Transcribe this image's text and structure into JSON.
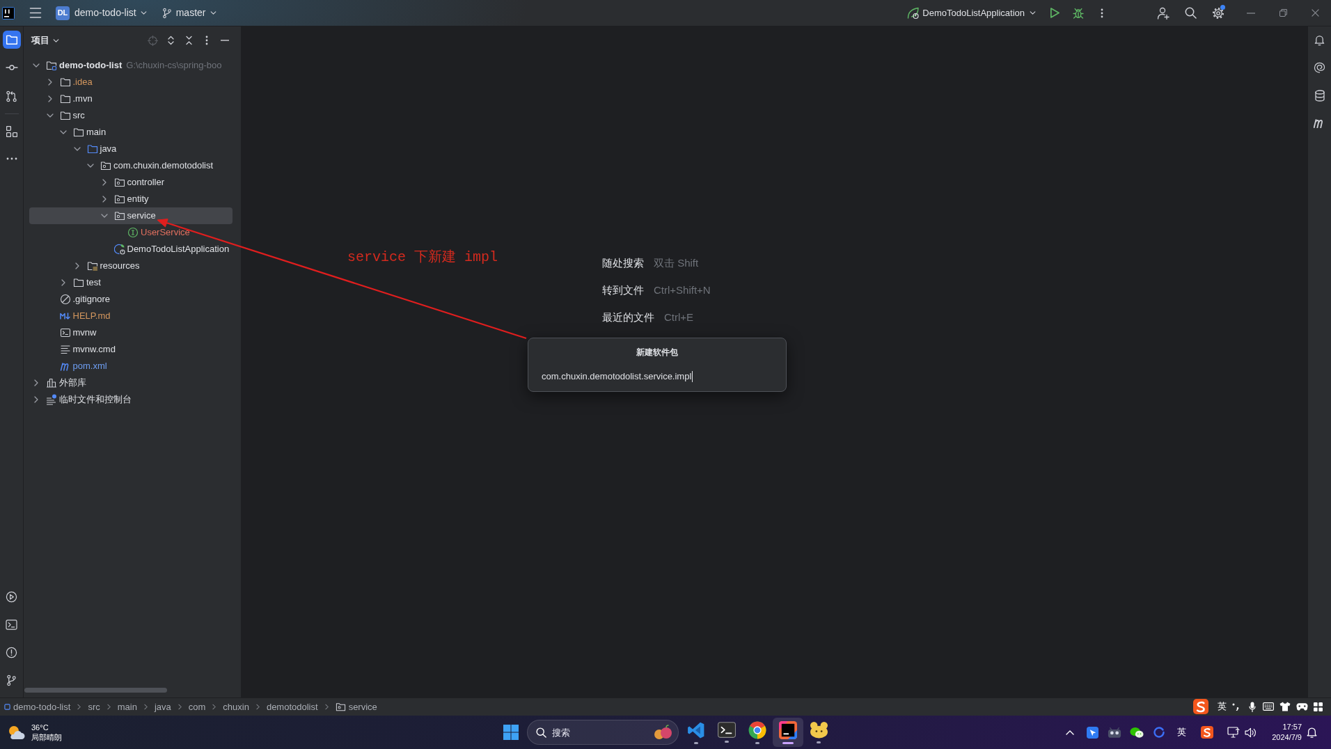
{
  "title_bar": {
    "project": {
      "badge": "DL",
      "name": "demo-todo-list"
    },
    "branch": "master",
    "run_configuration": "DemoTodoListApplication",
    "settings_update": true
  },
  "left_toolbar": {
    "top": [
      {
        "kind": "project",
        "selected": true
      },
      {
        "kind": "commit",
        "selected": false
      },
      {
        "kind": "pull_requests",
        "selected": false
      },
      {
        "kind": "structure",
        "selected": false
      },
      {
        "kind": "more",
        "selected": false
      }
    ],
    "bottom": [
      {
        "kind": "services",
        "selected": false
      },
      {
        "kind": "terminal",
        "selected": false
      },
      {
        "kind": "problems",
        "selected": false
      },
      {
        "kind": "git",
        "selected": false
      }
    ]
  },
  "project_panel": {
    "title": "项目",
    "tree": [
      {
        "label": "demo-todo-list",
        "kind": "module",
        "path": "G:\\chuxin-cs\\spring-boo",
        "expanded": true,
        "selected": false,
        "children": [
          {
            "label": ".idea",
            "kind": "folder",
            "color": "#d4975e",
            "expanded": false,
            "selected": false
          },
          {
            "label": ".mvn",
            "kind": "folder",
            "expanded": false,
            "selected": false
          },
          {
            "label": "src",
            "kind": "folder",
            "expanded": true,
            "selected": false,
            "children": [
              {
                "label": "main",
                "kind": "folder",
                "expanded": true,
                "selected": false,
                "children": [
                  {
                    "label": "java",
                    "kind": "source_root",
                    "expanded": true,
                    "selected": false,
                    "children": [
                      {
                        "label": "com.chuxin.demotodolist",
                        "kind": "package",
                        "expanded": true,
                        "selected": false,
                        "children": [
                          {
                            "label": "controller",
                            "kind": "package",
                            "expanded": false,
                            "selected": false
                          },
                          {
                            "label": "entity",
                            "kind": "package",
                            "expanded": false,
                            "selected": false
                          },
                          {
                            "label": "service",
                            "kind": "package",
                            "expanded": true,
                            "selected": true,
                            "children": [
                              {
                                "label": "UserService",
                                "kind": "interface",
                                "color": "#e2705f",
                                "selected": false
                              }
                            ]
                          },
                          {
                            "label": "DemoTodoListApplication",
                            "kind": "application_class",
                            "selected": false
                          }
                        ]
                      }
                    ]
                  },
                  {
                    "label": "resources",
                    "kind": "resources_root",
                    "expanded": false,
                    "selected": false
                  }
                ]
              },
              {
                "label": "test",
                "kind": "folder",
                "expanded": false,
                "selected": false
              }
            ]
          },
          {
            "label": ".gitignore",
            "kind": "ignore_file",
            "selected": false
          },
          {
            "label": "HELP.md",
            "kind": "markdown",
            "color": "#d4975e",
            "selected": false
          },
          {
            "label": "mvnw",
            "kind": "shell_script",
            "selected": false
          },
          {
            "label": "mvnw.cmd",
            "kind": "text_file",
            "selected": false
          },
          {
            "label": "pom.xml",
            "kind": "maven_pom",
            "color": "#6e9ef2",
            "selected": false
          }
        ]
      },
      {
        "label": "外部库",
        "kind": "libraries",
        "expanded": false,
        "selected": false
      },
      {
        "label": "临时文件和控制台",
        "kind": "scratches",
        "expanded": false,
        "selected": false
      }
    ]
  },
  "annotation": {
    "text": "service 下新建 impl"
  },
  "editor": {
    "hints": [
      {
        "action": "随处搜索",
        "shortcut": "双击 Shift"
      },
      {
        "action": "转到文件",
        "shortcut": "Ctrl+Shift+N"
      },
      {
        "action": "最近的文件",
        "shortcut": "Ctrl+E"
      }
    ]
  },
  "new_package_dialog": {
    "title": "新建软件包",
    "value": "com.chuxin.demotodolist.service.impl",
    "focused": true
  },
  "right_toolbar": [
    {
      "kind": "notifications"
    },
    {
      "kind": "ai_assistant"
    },
    {
      "kind": "database"
    },
    {
      "kind": "maven"
    }
  ],
  "breadcrumbs": [
    {
      "label": "demo-todo-list",
      "kind": "module"
    },
    {
      "label": "src",
      "kind": "plain"
    },
    {
      "label": "main",
      "kind": "plain"
    },
    {
      "label": "java",
      "kind": "plain"
    },
    {
      "label": "com",
      "kind": "plain"
    },
    {
      "label": "chuxin",
      "kind": "plain"
    },
    {
      "label": "demotodolist",
      "kind": "plain"
    },
    {
      "label": "service",
      "kind": "package"
    }
  ],
  "ime_toolbar": {
    "mode": "英"
  },
  "taskbar": {
    "weather": {
      "temperature": "36°C",
      "condition": "局部晴朗"
    },
    "search": {
      "placeholder": "搜索"
    },
    "apps": [
      {
        "kind": "code_editor",
        "selected": false
      },
      {
        "kind": "terminal",
        "selected": false
      },
      {
        "kind": "browser",
        "selected": false
      },
      {
        "kind": "ide",
        "selected": true
      },
      {
        "kind": "mascot",
        "selected": false
      }
    ],
    "input_language": "英",
    "time": "17:57",
    "date": "2024/7/9"
  }
}
